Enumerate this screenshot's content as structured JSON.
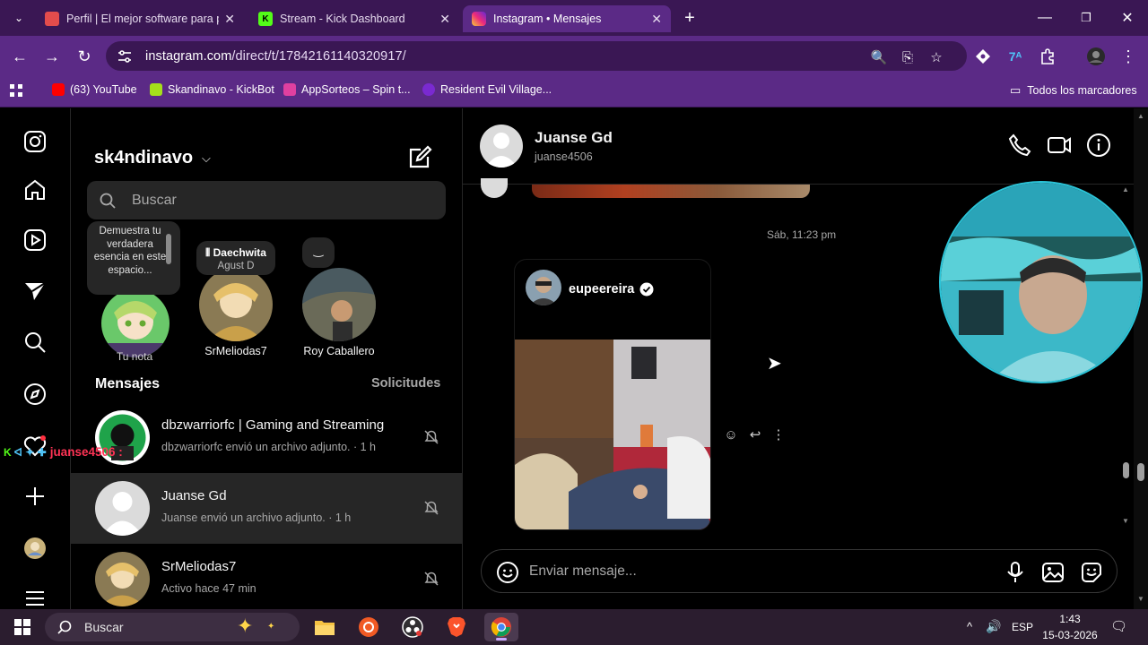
{
  "browser": {
    "tabs": [
      {
        "title": "Perfil | El mejor software para p",
        "active": false,
        "icon": "cube-icon",
        "color": "#e24c4c"
      },
      {
        "title": "Stream - Kick Dashboard",
        "active": false,
        "icon": "kick-icon",
        "color": "#53fc18"
      },
      {
        "title": "Instagram • Mensajes",
        "active": true,
        "icon": "instagram-icon",
        "color": "#e1306c"
      }
    ],
    "url_host": "instagram.com",
    "url_path": "/direct/t/17842161140320917/",
    "bookmarks": [
      {
        "label": "(63) YouTube",
        "color": "#ff0000"
      },
      {
        "label": "Skandinavo - KickBot",
        "color": "#a5e01a"
      },
      {
        "label": "AppSorteos – Spin t...",
        "color": "#e040a0"
      },
      {
        "label": "Resident Evil Village...",
        "color": "#7a2ad0"
      }
    ],
    "all_bookmarks_label": "Todos los marcadores"
  },
  "sidebar": {
    "username": "sk4ndinavo",
    "search_placeholder": "Buscar",
    "my_note": "Demuestra tu verdadera esencia en este espacio...",
    "my_note_label": "Tu nota",
    "stories": [
      {
        "note_name": "Daechwita",
        "note_sub": "Agust D",
        "label": "SrMeliodas7"
      },
      {
        "note_name": "‿",
        "note_sub": "",
        "label": "Roy Caballero"
      }
    ],
    "messages_title": "Mensajes",
    "requests_label": "Solicitudes",
    "conversations": [
      {
        "name": "dbzwarriorfc | Gaming and Streaming",
        "preview": "dbzwarriorfc envió un archivo adjunto. · 1 h",
        "selected": false
      },
      {
        "name": "Juanse Gd",
        "preview": "Juanse envió un archivo adjunto. · 1 h",
        "selected": true
      },
      {
        "name": "SrMeliodas7",
        "preview": "Activo hace 47 min",
        "selected": false
      }
    ]
  },
  "chat": {
    "name": "Juanse Gd",
    "username": "juanse4506",
    "timestamp": "Sáb, 11:23 pm",
    "shared_post_author": "eupeereira",
    "composer_placeholder": "Enviar mensaje..."
  },
  "overlay": {
    "chat_user": "juanse4506 :"
  },
  "taskbar": {
    "search_placeholder": "Buscar",
    "language": "ESP",
    "time": "1:43",
    "date": "15-03-2026"
  }
}
